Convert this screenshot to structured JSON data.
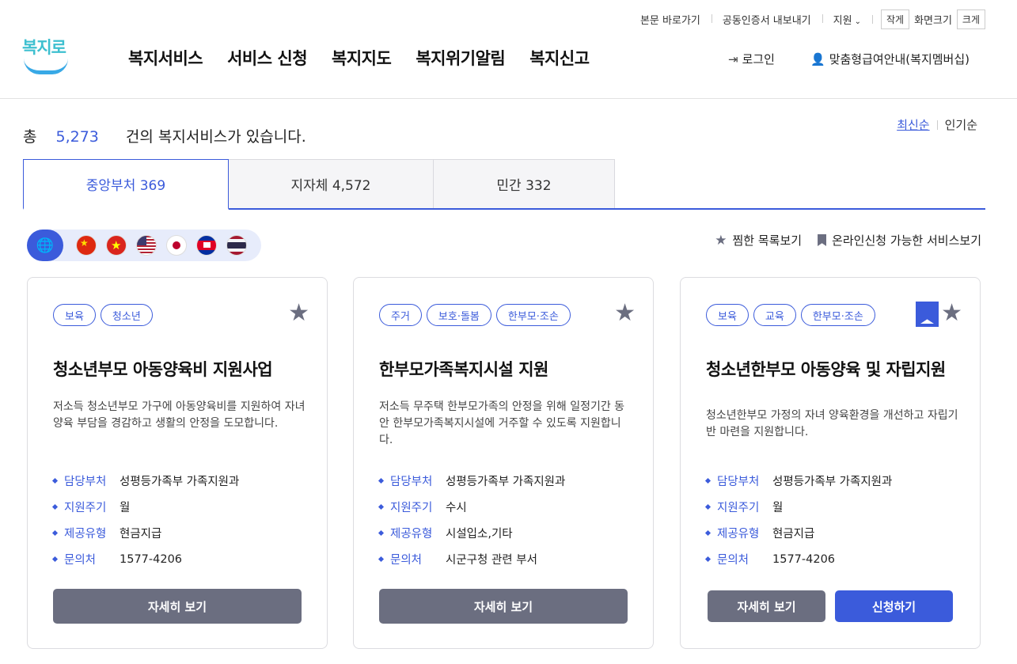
{
  "utility": {
    "skip": "본문 바로가기",
    "cert": "공동인증서 내보내기",
    "support": "지원",
    "small": "작게",
    "screen_size": "화면크기",
    "large": "크게"
  },
  "logo": {
    "text": "복지로"
  },
  "nav": [
    "복지서비스",
    "서비스 신청",
    "복지지도",
    "복지위기알림",
    "복지신고"
  ],
  "header": {
    "login": "로그인",
    "membership": "맞춤형급여안내(복지멤버십)"
  },
  "summary": {
    "prefix": "총",
    "total": "5,273",
    "suffix": "건의 복지서비스가 있습니다."
  },
  "sort": {
    "latest": "최신순",
    "popular": "인기순"
  },
  "tabs": [
    {
      "label": "중앙부처 369",
      "active": true
    },
    {
      "label": "지자체 4,572",
      "active": false
    },
    {
      "label": "민간 332",
      "active": false
    }
  ],
  "filters": {
    "favorites": "찜한 목록보기",
    "online": "온라인신청 가능한 서비스보기"
  },
  "cards": [
    {
      "tags": [
        "보육",
        "청소년"
      ],
      "title": "청소년부모 아동양육비 지원사업",
      "desc": "저소득 청소년부모 가구에 아동양육비를 지원하여 자녀양육 부담을 경감하고 생활의 안정을 도모합니다.",
      "meta": [
        {
          "label": "담당부처",
          "value": "성평등가족부 가족지원과"
        },
        {
          "label": "지원주기",
          "value": "월"
        },
        {
          "label": "제공유형",
          "value": "현금지급"
        },
        {
          "label": "문의처",
          "value": "1577-4206"
        }
      ],
      "detail": "자세히 보기"
    },
    {
      "tags": [
        "주거",
        "보호·돌봄",
        "한부모·조손"
      ],
      "title": "한부모가족복지시설 지원",
      "desc": "저소득 무주택 한부모가족의 안정을 위해 일정기간 동안 한부모가족복지시설에 거주할 수 있도록 지원합니다.",
      "meta": [
        {
          "label": "담당부처",
          "value": "성평등가족부 가족지원과"
        },
        {
          "label": "지원주기",
          "value": "수시"
        },
        {
          "label": "제공유형",
          "value": "시설입소,기타"
        },
        {
          "label": "문의처",
          "value": "시군구청 관련 부서"
        }
      ],
      "detail": "자세히 보기"
    },
    {
      "tags": [
        "보육",
        "교육",
        "한부모·조손"
      ],
      "title": "청소년한부모 아동양육 및 자립지원",
      "desc": "청소년한부모 가정의 자녀 양육환경을 개선하고 자립기반 마련을 지원합니다.",
      "meta": [
        {
          "label": "담당부처",
          "value": "성평등가족부 가족지원과"
        },
        {
          "label": "지원주기",
          "value": "월"
        },
        {
          "label": "제공유형",
          "value": "현금지급"
        },
        {
          "label": "문의처",
          "value": "1577-4206"
        }
      ],
      "detail": "자세히 보기",
      "apply": "신청하기"
    }
  ]
}
